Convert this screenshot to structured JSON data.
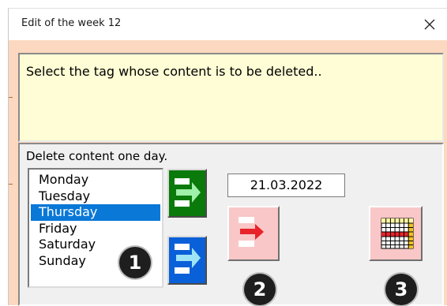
{
  "window": {
    "title": "Edit of the week 12",
    "close_glyph": "×"
  },
  "instruction": "Select the tag whose content is to be deleted..",
  "frame": {
    "caption": "Delete content one day.",
    "days": [
      "Monday",
      "Tuesday",
      "Thursday",
      "Friday",
      "Saturday",
      "Sunday"
    ],
    "selected_day": "Thursday",
    "date": "21.03.2022"
  },
  "buttons": {
    "copy_forward_icon": "arrow-right-icon",
    "copy_down_icon": "arrow-right-icon",
    "delete_icon": "delete-arrow-icon",
    "week_grid_icon": "calendar-grid-icon"
  },
  "badges": [
    "1",
    "2",
    "3"
  ],
  "colors": {
    "window_background": "#fbd8bf",
    "instruction_background": "#fffdd5",
    "selection": "#0a78d7",
    "green_button": "#0a7a0a",
    "blue_button": "#0a60d8",
    "pink_button": "#f9c7c7",
    "delete_arrow": "#e8242a"
  }
}
